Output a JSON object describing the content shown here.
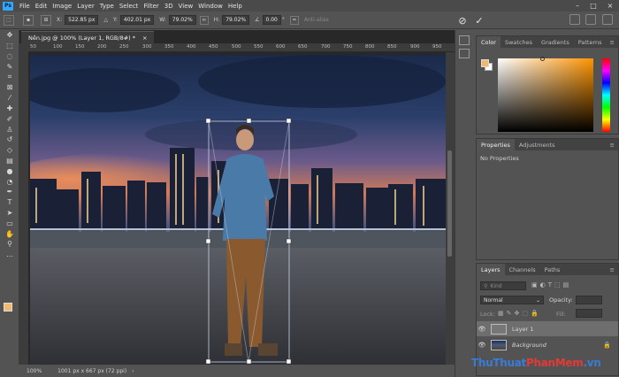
{
  "menu": {
    "app_logo": "Ps",
    "items": [
      "File",
      "Edit",
      "Image",
      "Layer",
      "Type",
      "Select",
      "Filter",
      "3D",
      "View",
      "Window",
      "Help"
    ]
  },
  "options": {
    "x_label": "X:",
    "x_value": "522.85 px",
    "y_label": "Y:",
    "y_value": "402.01 px",
    "w_label": "W:",
    "w_value": "79.02%",
    "h_label": "H:",
    "h_value": "79.02%",
    "angle_value": "0.00",
    "angle_unit": "°",
    "antialias_label": "Anti-alias"
  },
  "document": {
    "tab_title": "Nền.jpg @ 100% (Layer 1, RGB/8#) *",
    "tab_close": "×",
    "ruler_ticks": [
      "50",
      "100",
      "150",
      "200",
      "250",
      "300",
      "350",
      "400",
      "450",
      "500",
      "550",
      "600",
      "650",
      "700",
      "750",
      "800",
      "850",
      "900",
      "950"
    ]
  },
  "status": {
    "zoom": "100%",
    "doc_info": "1001 px x 667 px (72 ppi)"
  },
  "color_panel": {
    "tabs": [
      "Color",
      "Swatches",
      "Gradients",
      "Patterns"
    ],
    "foreground": "#f2b86e",
    "background": "#ffffff"
  },
  "properties_panel": {
    "tabs": [
      "Properties",
      "Adjustments"
    ],
    "empty_text": "No Properties"
  },
  "layers_panel": {
    "tabs": [
      "Layers",
      "Channels",
      "Paths"
    ],
    "filter_placeholder": "Kind",
    "blend_mode": "Normal",
    "opacity_label": "Opacity:",
    "lock_label": "Lock:",
    "fill_label": "Fill:",
    "layers": [
      {
        "name": "Layer 1",
        "selected": true
      },
      {
        "name": "Background",
        "selected": false
      }
    ]
  },
  "watermark": {
    "part1": "ThuThuat",
    "part2": "PhanMem",
    "part3": ".vn",
    "color1": "#3a7bd5",
    "color2": "#e53935",
    "color3": "#3a7bd5"
  },
  "icons": {
    "tools": [
      "move-icon",
      "marquee-icon",
      "lasso-icon",
      "quick-select-icon",
      "crop-icon",
      "frame-icon",
      "eyedropper-icon",
      "healing-icon",
      "brush-icon",
      "clone-stamp-icon",
      "history-brush-icon",
      "eraser-icon",
      "gradient-icon",
      "blur-icon",
      "dodge-icon",
      "pen-icon",
      "type-icon",
      "path-select-icon",
      "rectangle-icon",
      "hand-icon",
      "zoom-icon",
      "more-tools-icon"
    ]
  }
}
